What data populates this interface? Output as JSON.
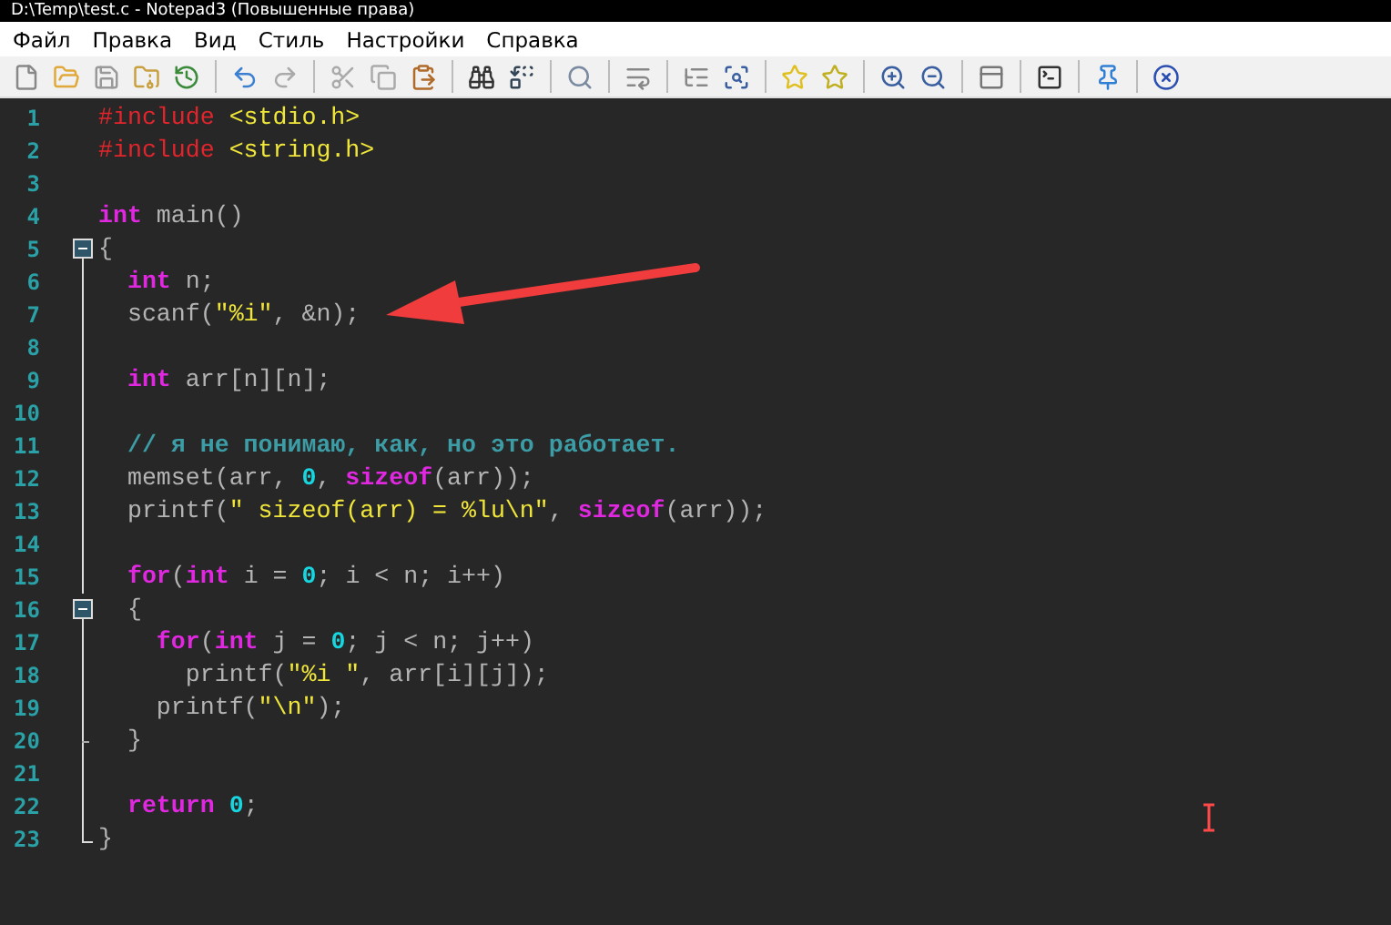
{
  "window": {
    "title": "D:\\Temp\\test.c - Notepad3 (Повышенные права)"
  },
  "menu": [
    {
      "label": "Файл"
    },
    {
      "label": "Правка"
    },
    {
      "label": "Вид"
    },
    {
      "label": "Стиль"
    },
    {
      "label": "Настройки"
    },
    {
      "label": "Справка"
    }
  ],
  "editor": {
    "lines": [
      {
        "number": "1",
        "kind": "plain",
        "tokens": [
          {
            "kind": "preproc",
            "text": "#include"
          },
          {
            "kind": "header",
            "text": " <stdio.h>"
          }
        ]
      },
      {
        "number": "2",
        "kind": "plain",
        "tokens": [
          {
            "kind": "preproc",
            "text": "#include"
          },
          {
            "kind": "header",
            "text": " <string.h>"
          }
        ]
      },
      {
        "number": "3",
        "kind": "plain"
      },
      {
        "number": "4",
        "kind": "plain",
        "tokens": [
          {
            "kind": "keyword",
            "text": "int"
          },
          {
            "kind": "plain",
            "text": " main()"
          }
        ]
      },
      {
        "number": "5",
        "kind": "fold_start",
        "tokens": [
          {
            "kind": "plain",
            "text": "{"
          }
        ]
      },
      {
        "number": "6",
        "kind": "fold_body",
        "tokens": [
          {
            "kind": "keyword",
            "text": "  int"
          },
          {
            "kind": "plain",
            "text": " n;"
          }
        ]
      },
      {
        "number": "7",
        "kind": "fold_body",
        "tokens": [
          {
            "kind": "plain",
            "text": "  scanf("
          },
          {
            "kind": "string",
            "text": "\"%i\""
          },
          {
            "kind": "plain",
            "text": ", &n);"
          }
        ]
      },
      {
        "number": "8",
        "kind": "fold_body"
      },
      {
        "number": "9",
        "kind": "fold_body",
        "tokens": [
          {
            "kind": "keyword",
            "text": "  int"
          },
          {
            "kind": "plain",
            "text": " arr[n][n];"
          }
        ]
      },
      {
        "number": "10",
        "kind": "fold_body"
      },
      {
        "number": "11",
        "kind": "fold_body",
        "tokens": [
          {
            "kind": "comment",
            "text": "  // я не понимаю, как, но это работает."
          }
        ]
      },
      {
        "number": "12",
        "kind": "fold_body",
        "tokens": [
          {
            "kind": "plain",
            "text": "  memset(arr, "
          },
          {
            "kind": "number",
            "text": "0"
          },
          {
            "kind": "plain",
            "text": ", "
          },
          {
            "kind": "keyword",
            "text": "sizeof"
          },
          {
            "kind": "plain",
            "text": "(arr));"
          }
        ]
      },
      {
        "number": "13",
        "kind": "fold_body",
        "tokens": [
          {
            "kind": "plain",
            "text": "  printf("
          },
          {
            "kind": "string",
            "text": "\" sizeof(arr) = %lu\\n\""
          },
          {
            "kind": "plain",
            "text": ", "
          },
          {
            "kind": "keyword",
            "text": "sizeof"
          },
          {
            "kind": "plain",
            "text": "(arr));"
          }
        ]
      },
      {
        "number": "14",
        "kind": "fold_body"
      },
      {
        "number": "15",
        "kind": "fold_body",
        "tokens": [
          {
            "kind": "keyword",
            "text": "  for"
          },
          {
            "kind": "plain",
            "text": "("
          },
          {
            "kind": "keyword",
            "text": "int"
          },
          {
            "kind": "plain",
            "text": " i = "
          },
          {
            "kind": "number",
            "text": "0"
          },
          {
            "kind": "plain",
            "text": "; i < n; i++)"
          }
        ]
      },
      {
        "number": "16",
        "kind": "fold_start",
        "tokens": [
          {
            "kind": "plain",
            "text": "  {"
          }
        ]
      },
      {
        "number": "17",
        "kind": "fold_body",
        "tokens": [
          {
            "kind": "keyword",
            "text": "    for"
          },
          {
            "kind": "plain",
            "text": "("
          },
          {
            "kind": "keyword",
            "text": "int"
          },
          {
            "kind": "plain",
            "text": " j = "
          },
          {
            "kind": "number",
            "text": "0"
          },
          {
            "kind": "plain",
            "text": "; j < n; j++)"
          }
        ]
      },
      {
        "number": "18",
        "kind": "fold_body",
        "tokens": [
          {
            "kind": "plain",
            "text": "      printf("
          },
          {
            "kind": "string",
            "text": "\"%i \""
          },
          {
            "kind": "plain",
            "text": ", arr[i][j]);"
          }
        ]
      },
      {
        "number": "19",
        "kind": "fold_body",
        "tokens": [
          {
            "kind": "plain",
            "text": "    printf("
          },
          {
            "kind": "string",
            "text": "\"\\n\""
          },
          {
            "kind": "plain",
            "text": ");"
          }
        ]
      },
      {
        "number": "20",
        "kind": "fold_end",
        "tokens": [
          {
            "kind": "plain",
            "text": "  }"
          }
        ]
      },
      {
        "number": "21",
        "kind": "fold_body"
      },
      {
        "number": "22",
        "kind": "fold_body",
        "tokens": [
          {
            "kind": "keyword",
            "text": "  return"
          },
          {
            "kind": "number",
            "text": " 0"
          },
          {
            "kind": "plain",
            "text": ";"
          }
        ]
      },
      {
        "number": "23",
        "kind": "fold_last",
        "tokens": [
          {
            "kind": "plain",
            "text": "}"
          }
        ]
      }
    ]
  }
}
